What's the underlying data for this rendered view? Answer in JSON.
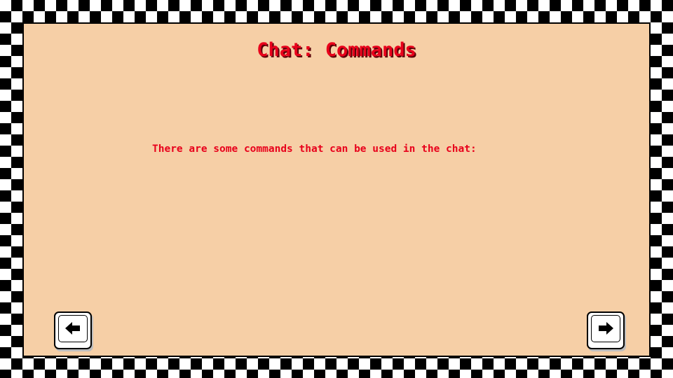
{
  "screen": {
    "title": "Chat: Commands",
    "description": "There are some commands that can be used in the chat:"
  },
  "navigation": {
    "prev_icon": "arrow-left-icon",
    "next_icon": "arrow-right-icon"
  },
  "colors": {
    "panel_background": "#f6cfa6",
    "text": "#e8001b",
    "checker_dark": "#000000",
    "checker_light": "#ffffff"
  }
}
